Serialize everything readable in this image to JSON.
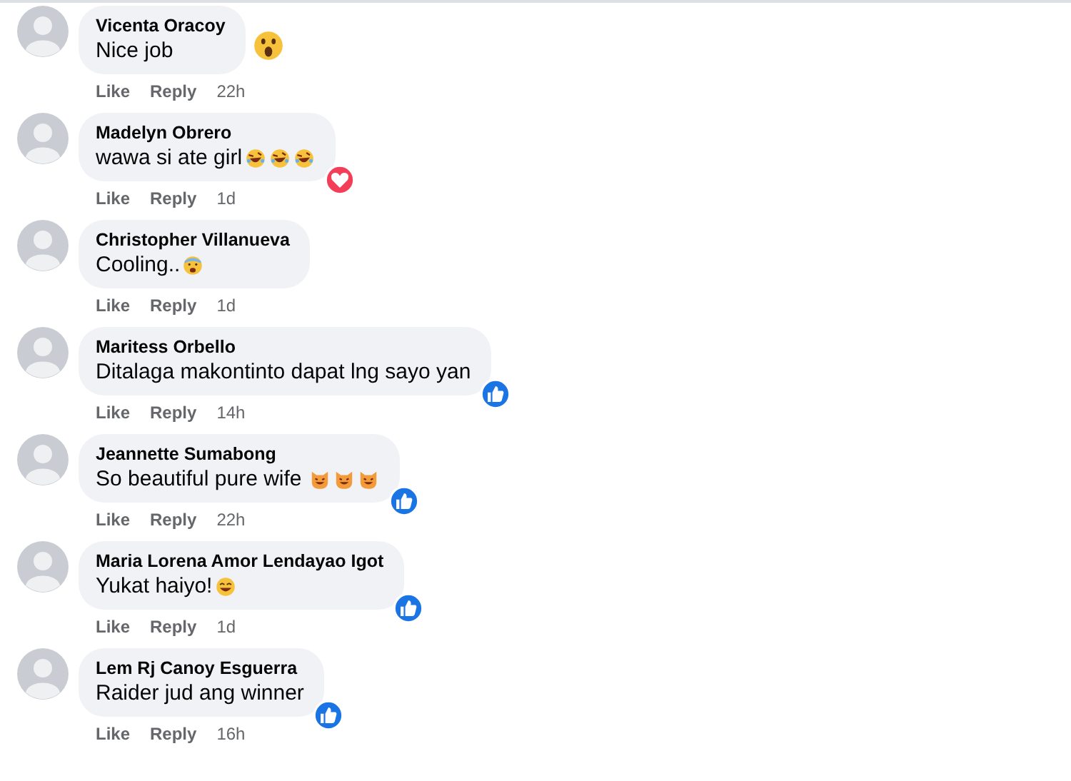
{
  "comments": [
    {
      "name": "Vicenta Oracoy",
      "text": "Nice job",
      "reaction": {
        "kind": "wow"
      },
      "actions": [
        "Like",
        "Reply"
      ],
      "time": "22h"
    },
    {
      "name": "Madelyn Obrero",
      "text": "wawa si ate girl",
      "inline_emojis": [
        {
          "kind": "rofl"
        },
        {
          "kind": "rofl"
        },
        {
          "kind": "rofl"
        }
      ],
      "reaction": {
        "kind": "love"
      },
      "actions": [
        "Like",
        "Reply"
      ],
      "time": "1d"
    },
    {
      "name": "Christopher Villanueva",
      "text": "Cooling..",
      "inline_emojis": [
        {
          "kind": "sweat"
        }
      ],
      "actions": [
        "Like",
        "Reply"
      ],
      "time": "1d"
    },
    {
      "name": "Maritess Orbello",
      "text": "Ditalaga makontinto dapat lng sayo yan",
      "reaction": {
        "kind": "like"
      },
      "actions": [
        "Like",
        "Reply"
      ],
      "time": "14h"
    },
    {
      "name": "Jeannette Sumabong",
      "text": "So beautiful pure wife ",
      "inline_emojis": [
        {
          "kind": "cat"
        },
        {
          "kind": "cat"
        },
        {
          "kind": "cat"
        }
      ],
      "reaction": {
        "kind": "like"
      },
      "actions": [
        "Like",
        "Reply"
      ],
      "time": "22h"
    },
    {
      "name": "Maria Lorena Amor Lendayao Igot",
      "text": "Yukat haiyo!",
      "inline_emojis": [
        {
          "kind": "grin"
        }
      ],
      "reaction": {
        "kind": "like"
      },
      "actions": [
        "Like",
        "Reply"
      ],
      "time": "1d"
    },
    {
      "name": "Lem Rj Canoy Esguerra",
      "text": "Raider jud ang winner",
      "reaction": {
        "kind": "like"
      },
      "actions": [
        "Like",
        "Reply"
      ],
      "time": "16h"
    }
  ]
}
